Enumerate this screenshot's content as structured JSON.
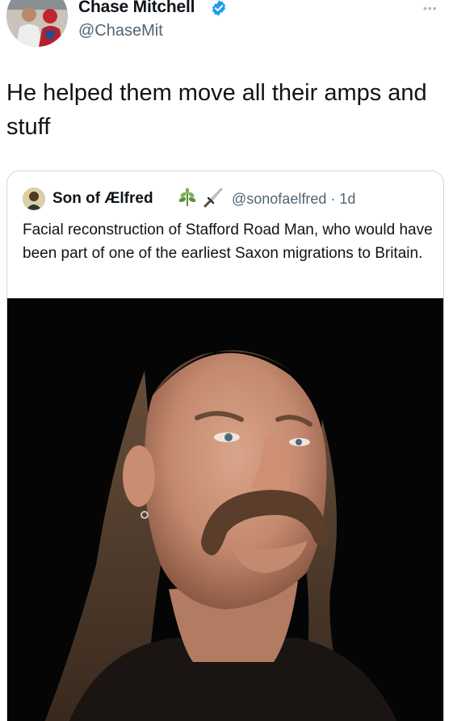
{
  "author": {
    "display_name": "Chase Mitchell",
    "handle": "@ChaseMit",
    "avatar": "profile-avatar",
    "verified_icon": "verified-badge-icon"
  },
  "more_icon": "more-options-icon",
  "more_label": "•••",
  "tweet": {
    "text": "He helped them move all their amps and stuff"
  },
  "quoted": {
    "display_name": "Son of Ælfred",
    "emojis": [
      "herb-icon",
      "dagger-icon"
    ],
    "handle": "@sonofaelfred",
    "separator": "·",
    "time": "1d",
    "text": "Facial reconstruction of Stafford Road Man, who would have been part of one of the earliest Saxon migrations to Britain.",
    "media": "facial-reconstruction-photo"
  },
  "colors": {
    "text_primary": "#0f1419",
    "text_secondary": "#536471",
    "verified_blue": "#1d9bf0",
    "card_border": "#cfd9de",
    "photo_background": "#050505"
  }
}
